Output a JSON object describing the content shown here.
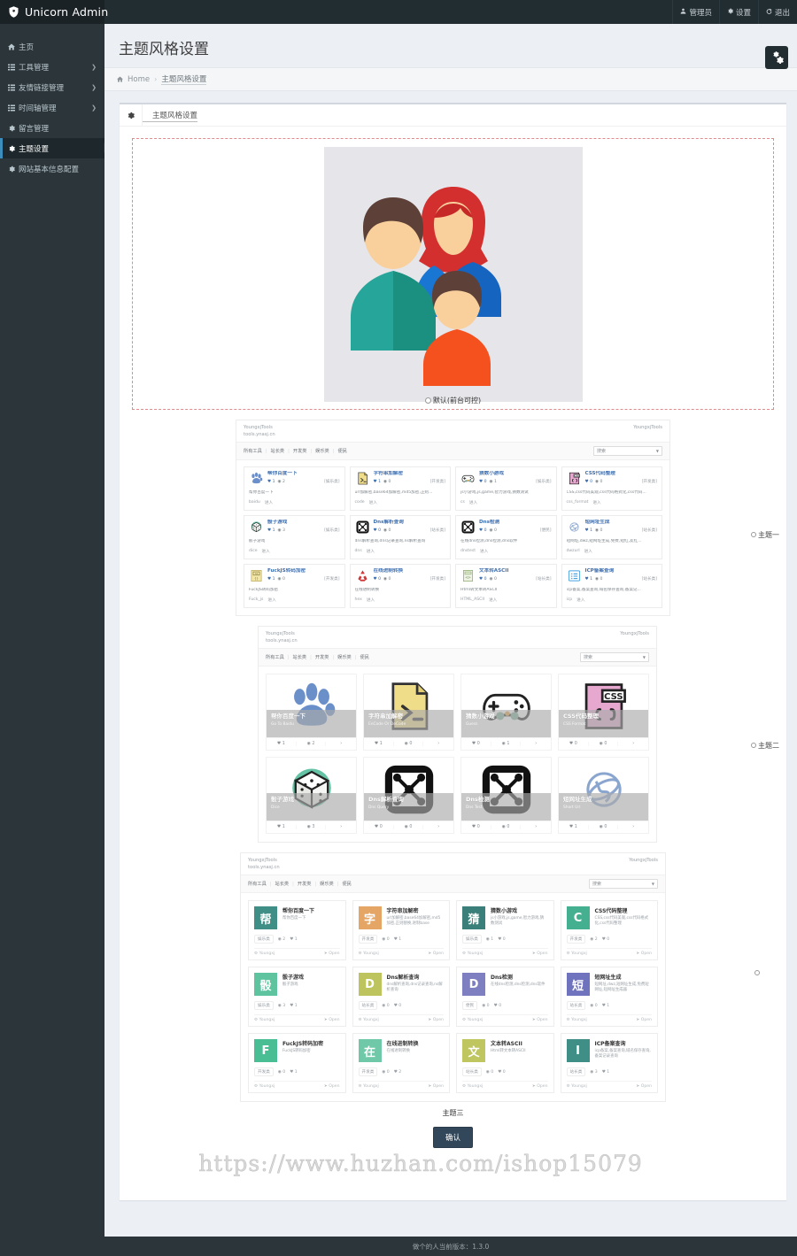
{
  "brand": {
    "name": "Unicorn Admin",
    "logo_icon": "unicorn-logo"
  },
  "topnav": [
    {
      "label": "管理员",
      "icon": "user-icon"
    },
    {
      "label": "设置",
      "icon": "gear-icon"
    },
    {
      "label": "退出",
      "icon": "logout-icon"
    }
  ],
  "sidebar": {
    "items": [
      {
        "label": "主页",
        "icon": "home-icon",
        "has_arrow": false,
        "active": false
      },
      {
        "label": "工具管理",
        "icon": "list-icon",
        "has_arrow": true,
        "active": false
      },
      {
        "label": "友情链接管理",
        "icon": "list-icon",
        "has_arrow": true,
        "active": false
      },
      {
        "label": "时间轴管理",
        "icon": "list-icon",
        "has_arrow": true,
        "active": false
      },
      {
        "label": "留言管理",
        "icon": "gear-icon",
        "has_arrow": false,
        "active": false
      },
      {
        "label": "主题设置",
        "icon": "gear-icon",
        "has_arrow": false,
        "active": true
      },
      {
        "label": "网站基本信息配置",
        "icon": "gear-icon",
        "has_arrow": false,
        "active": false
      }
    ]
  },
  "header": {
    "page_title": "主题风格设置",
    "settings_button_icon": "gears-icon"
  },
  "breadcrumb": {
    "home": "Home",
    "separator": "›",
    "current": "主题风格设置",
    "home_icon": "home-icon"
  },
  "panel": {
    "icon": "gear-icon",
    "title": "主题风格设置"
  },
  "hero": {
    "label": "默认(前台可控)",
    "selected": false,
    "illustration": "family-avatars-illustration"
  },
  "site_mock": {
    "brand_line1": "YoungxjTools",
    "brand_line2": "tools.ynasj.cn",
    "brand_right": "YoungxjTools",
    "nav": [
      "所有工具",
      "站长类",
      "开发类",
      "娱乐类",
      "便民"
    ],
    "search_placeholder": "搜索",
    "caret_icon": "chevron-down-icon"
  },
  "themes": [
    {
      "id": "theme-one",
      "radio_label": "主题一",
      "selected": false,
      "cards": [
        {
          "name": "帮你百度一下",
          "likes": "1",
          "views": "2",
          "tag": "[娱乐类]",
          "desc": "帮你百度一下",
          "code": "baidu",
          "action": "进入",
          "icon": "paw-icon",
          "color": "#6b8fc9"
        },
        {
          "name": "字符串加解密",
          "likes": "1",
          "views": "0",
          "tag": "[开发类]",
          "desc": "url加解密,base64加解密,md5加密,正则...",
          "code": "code",
          "action": "进入",
          "icon": "file-terminal-icon",
          "color": "#e7d27c"
        },
        {
          "name": "猜数小游戏",
          "likes": "0",
          "views": "1",
          "tag": "[娱乐类]",
          "desc": "js小游戏,js,game,智力游戏,猜数测试",
          "code": "cs",
          "action": "进入",
          "icon": "gamepad-icon",
          "color": "#444"
        },
        {
          "name": "CSS代码整理",
          "likes": "0",
          "views": "0",
          "tag": "[开发类]",
          "desc": "CSS,css代码美观,css代码格式化,css代码...",
          "code": "css_format",
          "action": "进入",
          "icon": "css-file-icon",
          "color": "#e4b8d8"
        },
        {
          "name": "骰子游戏",
          "likes": "1",
          "views": "3",
          "tag": "[娱乐类]",
          "desc": "骰子游戏",
          "code": "dice",
          "action": "进入",
          "icon": "dice-icon",
          "color": "#5cb89a"
        },
        {
          "name": "Dns解析查询",
          "likes": "0",
          "views": "0",
          "tag": "[站长类]",
          "desc": "dns解析查询,dns记录查询,ns解析查询",
          "code": "dns",
          "action": "进入",
          "icon": "dns-icon",
          "color": "#111"
        },
        {
          "name": "Dns检测",
          "likes": "0",
          "views": "0",
          "tag": "[便民]",
          "desc": "在线dns检测,dns检测,dns软件",
          "code": "dnstest",
          "action": "进入",
          "icon": "dns-icon",
          "color": "#111"
        },
        {
          "name": "短网址生成",
          "likes": "1",
          "views": "0",
          "tag": "[站长类]",
          "desc": "短网址,dwz,短网址生成,免费,短红,友红...",
          "code": "dwzurl",
          "action": "进入",
          "icon": "globe-icon",
          "color": "#8aa6cf"
        },
        {
          "name": "FuckJS转码加密",
          "likes": "1",
          "views": "0",
          "tag": "[开发类]",
          "desc": "FuckJS转码加密",
          "code": "Fuck_js",
          "action": "进入",
          "icon": "brackets-icon",
          "color": "#d8c98a"
        },
        {
          "name": "在线进制转换",
          "likes": "0",
          "views": "0",
          "tag": "[开发类]",
          "desc": "在线进制转换",
          "code": "hex",
          "action": "进入",
          "icon": "recycle-icon",
          "color": "#d24343"
        },
        {
          "name": "文本转ASCII",
          "likes": "0",
          "views": "0",
          "tag": "[站长类]",
          "desc": "Html转文本转ASCII",
          "code": "HTML_ASCII",
          "action": "进入",
          "icon": "code-file-icon",
          "color": "#8aa86b"
        },
        {
          "name": "ICP备案查询",
          "likes": "1",
          "views": "0",
          "tag": "[站长类]",
          "desc": "icp备案,备案查询,域名保存查询,备案记...",
          "code": "icp",
          "action": "进入",
          "icon": "listbox-icon",
          "color": "#4aa3df"
        }
      ]
    },
    {
      "id": "theme-two",
      "radio_label": "主题二",
      "selected": false,
      "cards": [
        {
          "title": "帮你百度一下",
          "sub": "Go To Baidu",
          "likes": "1",
          "views": "2",
          "more": "›",
          "icon": "paw-icon"
        },
        {
          "title": "字符串加解密",
          "sub": "EnCode Or DeCode",
          "likes": "1",
          "views": "0",
          "more": "›",
          "icon": "file-terminal-icon"
        },
        {
          "title": "猜数小游戏",
          "sub": "Guess",
          "likes": "0",
          "views": "1",
          "more": "›",
          "icon": "gamepad-icon"
        },
        {
          "title": "CSS代码整理",
          "sub": "CSS Format",
          "likes": "0",
          "views": "0",
          "more": "›",
          "icon": "css-file-icon"
        },
        {
          "title": "骰子游戏",
          "sub": "Dice",
          "likes": "1",
          "views": "3",
          "more": "›",
          "icon": "dice-icon"
        },
        {
          "title": "Dns解析查询",
          "sub": "Dns Query",
          "likes": "0",
          "views": "0",
          "more": "›",
          "icon": "dns-icon"
        },
        {
          "title": "Dns检测",
          "sub": "Dns Test",
          "likes": "0",
          "views": "0",
          "more": "›",
          "icon": "dns-icon"
        },
        {
          "title": "短网址生成",
          "sub": "Short Url",
          "likes": "1",
          "views": "0",
          "more": "›",
          "icon": "globe-icon"
        }
      ]
    },
    {
      "id": "theme-three",
      "radio_label": "主题三",
      "selected": false,
      "cards": [
        {
          "letter": "帮",
          "name": "帮你百度一下",
          "desc": "帮你百度一下",
          "tag": "娱乐类",
          "views": "2",
          "likes": "1",
          "author": "Youngxj",
          "open": "Open",
          "color": "#3f8f86"
        },
        {
          "letter": "字",
          "name": "字符串加解密",
          "desc": "url加解密,base64加解密,md5加密,正则替换,进制base",
          "tag": "开发类",
          "views": "0",
          "likes": "1",
          "author": "Youngxj",
          "open": "Open",
          "color": "#e5a564"
        },
        {
          "letter": "猜",
          "name": "猜数小游戏",
          "desc": "js小游戏,js,game,智力游戏,猜数测试",
          "tag": "娱乐类",
          "views": "1",
          "likes": "0",
          "author": "Youngxj",
          "open": "Open",
          "color": "#3a7f7a"
        },
        {
          "letter": "C",
          "name": "CSS代码整理",
          "desc": "CSS,css代码美观,css代码格式化,css代码整理",
          "tag": "开发类",
          "views": "2",
          "likes": "0",
          "author": "Youngxj",
          "open": "Open",
          "color": "#45b08f"
        },
        {
          "letter": "骰",
          "name": "骰子游戏",
          "desc": "骰子游戏",
          "tag": "娱乐类",
          "views": "3",
          "likes": "1",
          "author": "Youngxj",
          "open": "Open",
          "color": "#5ec4a0"
        },
        {
          "letter": "D",
          "name": "Dns解析查询",
          "desc": "dns解析查询,dns记录查询,ns解析查询",
          "tag": "站长类",
          "views": "0",
          "likes": "0",
          "author": "Youngxj",
          "open": "Open",
          "color": "#bdc45e"
        },
        {
          "letter": "D",
          "name": "Dns检测",
          "desc": "在线dns检测,dns检测,dns软件",
          "tag": "便民",
          "views": "0",
          "likes": "0",
          "author": "Youngxj",
          "open": "Open",
          "color": "#7e7fc0"
        },
        {
          "letter": "短",
          "name": "短网址生成",
          "desc": "短网址,dwz,短网址生成,免费短网址,短网址生成器",
          "tag": "站长类",
          "views": "0",
          "likes": "1",
          "author": "Youngxj",
          "open": "Open",
          "color": "#6f72bd"
        },
        {
          "letter": "F",
          "name": "FuckJS转码加密",
          "desc": "FuckJS转码加密",
          "tag": "开发类",
          "views": "0",
          "likes": "1",
          "author": "Youngxj",
          "open": "Open",
          "color": "#49bd94"
        },
        {
          "letter": "在",
          "name": "在线进制转换",
          "desc": "在线进制转换",
          "tag": "开发类",
          "views": "0",
          "likes": "2",
          "author": "Youngxj",
          "open": "Open",
          "color": "#6fc8a8"
        },
        {
          "letter": "文",
          "name": "文本转ASCII",
          "desc": "Html转文本转ASCII",
          "tag": "站长类",
          "views": "0",
          "likes": "0",
          "author": "Youngxj",
          "open": "Open",
          "color": "#bfc55f"
        },
        {
          "letter": "I",
          "name": "ICP备案查询",
          "desc": "icp备案,备案查询,域名保存查询,备案记录查询",
          "tag": "站长类",
          "views": "3",
          "likes": "1",
          "author": "Youngxj",
          "open": "Open",
          "color": "#3f8f86"
        }
      ]
    }
  ],
  "theme3_caption": "主题三",
  "confirm_button": "确认",
  "watermark": "https://www.huzhan.com/ishop15079",
  "footer": "做个的人当前版本：1.3.0"
}
